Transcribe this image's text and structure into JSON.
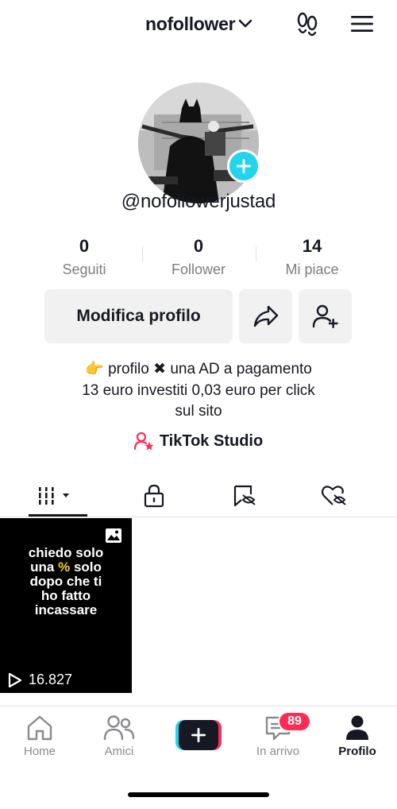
{
  "header": {
    "account_name": "nofollower",
    "footprint_icon": "footprint-icon",
    "menu_icon": "hamburger-menu-icon"
  },
  "profile": {
    "handle": "@nofollowerjustad",
    "stats": {
      "following_count": "0",
      "following_label": "Seguiti",
      "followers_count": "0",
      "followers_label": "Follower",
      "likes_count": "14",
      "likes_label": "Mi piace"
    },
    "edit_button": "Modifica profilo",
    "bio": {
      "line1_emoji": "👉",
      "line1_a": "profilo",
      "line1_x": "✖",
      "line1_b": "una AD a pagamento",
      "line2": "13 euro investiti 0,03 euro per click",
      "line3": "sul sito"
    },
    "studio_link": "TikTok Studio"
  },
  "tabs": [
    {
      "name": "videos",
      "icon": "grid-icon",
      "active": true
    },
    {
      "name": "private",
      "icon": "lock-icon"
    },
    {
      "name": "saved",
      "icon": "hidden-bookmark-icon"
    },
    {
      "name": "liked",
      "icon": "hidden-heart-icon"
    }
  ],
  "videos": [
    {
      "text_pre": "chiedo solo",
      "text_line2_a": "una",
      "text_line2_hl": "%",
      "text_line2_b": "solo",
      "text_line3": "dopo che ti",
      "text_line4": "ho fatto",
      "text_line5": "incassare",
      "views": "16.827"
    }
  ],
  "bottom_nav": {
    "home": "Home",
    "friends": "Amici",
    "inbox": "In arrivo",
    "inbox_badge": "89",
    "profile": "Profilo"
  },
  "colors": {
    "accent_cyan": "#20d5ec",
    "accent_red": "#fe2c55",
    "text": "#161823",
    "muted": "#7d7d82",
    "button_bg": "#f1f1f2"
  }
}
